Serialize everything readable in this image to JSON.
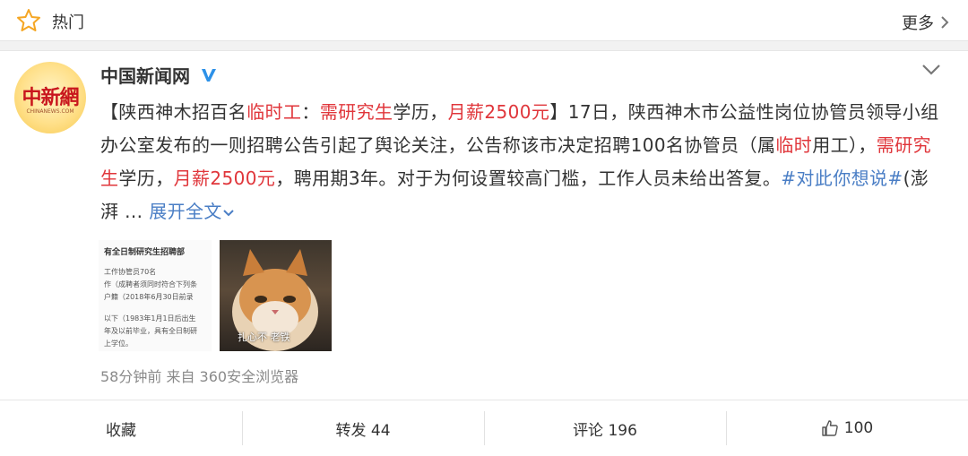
{
  "header": {
    "title": "热门",
    "more_label": "更多"
  },
  "post": {
    "author": "中国新闻网",
    "avatar_text": "中新網",
    "avatar_sub": "CHINANEWS.COM",
    "text_segments": [
      {
        "t": "【陕西神木招百名",
        "style": "normal"
      },
      {
        "t": "临时工",
        "style": "red"
      },
      {
        "t": "：",
        "style": "normal"
      },
      {
        "t": "需研究生",
        "style": "red"
      },
      {
        "t": "学历，",
        "style": "normal"
      },
      {
        "t": "月薪2500元",
        "style": "red"
      },
      {
        "t": "】17日，陕西神木市公益性岗位协管员领导小组办公室发布的一则招聘公告引起了舆论关注，公告称该市决定招聘100名协管员（属",
        "style": "normal"
      },
      {
        "t": "临时",
        "style": "red"
      },
      {
        "t": "用工），",
        "style": "normal"
      },
      {
        "t": "需研究生",
        "style": "red"
      },
      {
        "t": "学历，",
        "style": "normal"
      },
      {
        "t": "月薪2500元",
        "style": "red"
      },
      {
        "t": "，聘用期3年。对于为何设置较高门槛，工作人员未给出答复。",
        "style": "normal"
      },
      {
        "t": "#对此你想说#",
        "style": "link"
      },
      {
        "t": "(澎湃 ... ",
        "style": "normal"
      }
    ],
    "expand_label": "展开全文",
    "thumb1": {
      "heading": "有全日制研究生招聘部",
      "lines": [
        "工作协管员70名",
        "作（成聘者须同时符合下列条",
        "户籍（2018年6月30日前录",
        "以下（1983年1月1日后出生",
        "年及以前毕业，具有全日制研",
        "上学位。"
      ]
    },
    "thumb2_caption": "扎心不 老铁",
    "meta": "58分钟前 来自 360安全浏览器"
  },
  "actions": {
    "favorite": "收藏",
    "repost": "转发 44",
    "comment": "评论 196",
    "like": "100"
  }
}
